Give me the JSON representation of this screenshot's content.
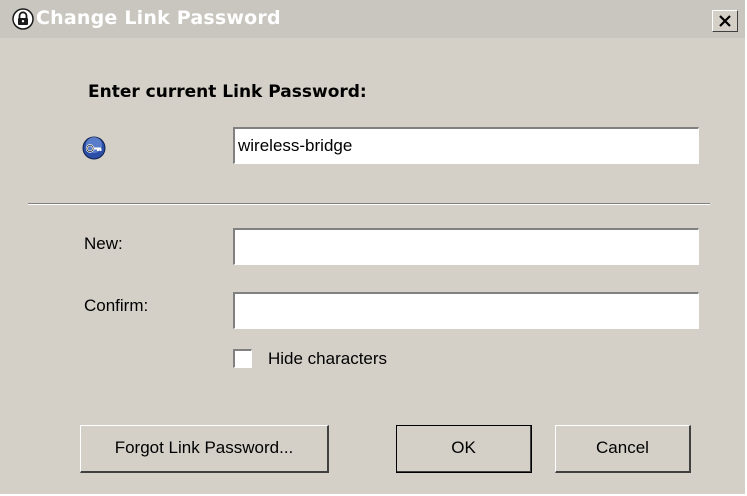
{
  "window": {
    "title": "Change Link Password",
    "icon": "lock-icon",
    "close_label": "close-icon"
  },
  "current": {
    "heading": "Enter current Link Password:",
    "icon": "key-icon",
    "value": "wireless-bridge"
  },
  "new_password": {
    "new_label": "New:",
    "new_value": "",
    "confirm_label": "Confirm:",
    "confirm_value": "",
    "hide_label": "Hide characters",
    "hide_checked": false
  },
  "buttons": {
    "forgot_label": "Forgot Link Password...",
    "ok_label": "OK",
    "cancel_label": "Cancel"
  },
  "colors": {
    "face": "#d4d0c8",
    "title_bar": "#c9c6bf",
    "key_blue": "#2c4fa8"
  }
}
